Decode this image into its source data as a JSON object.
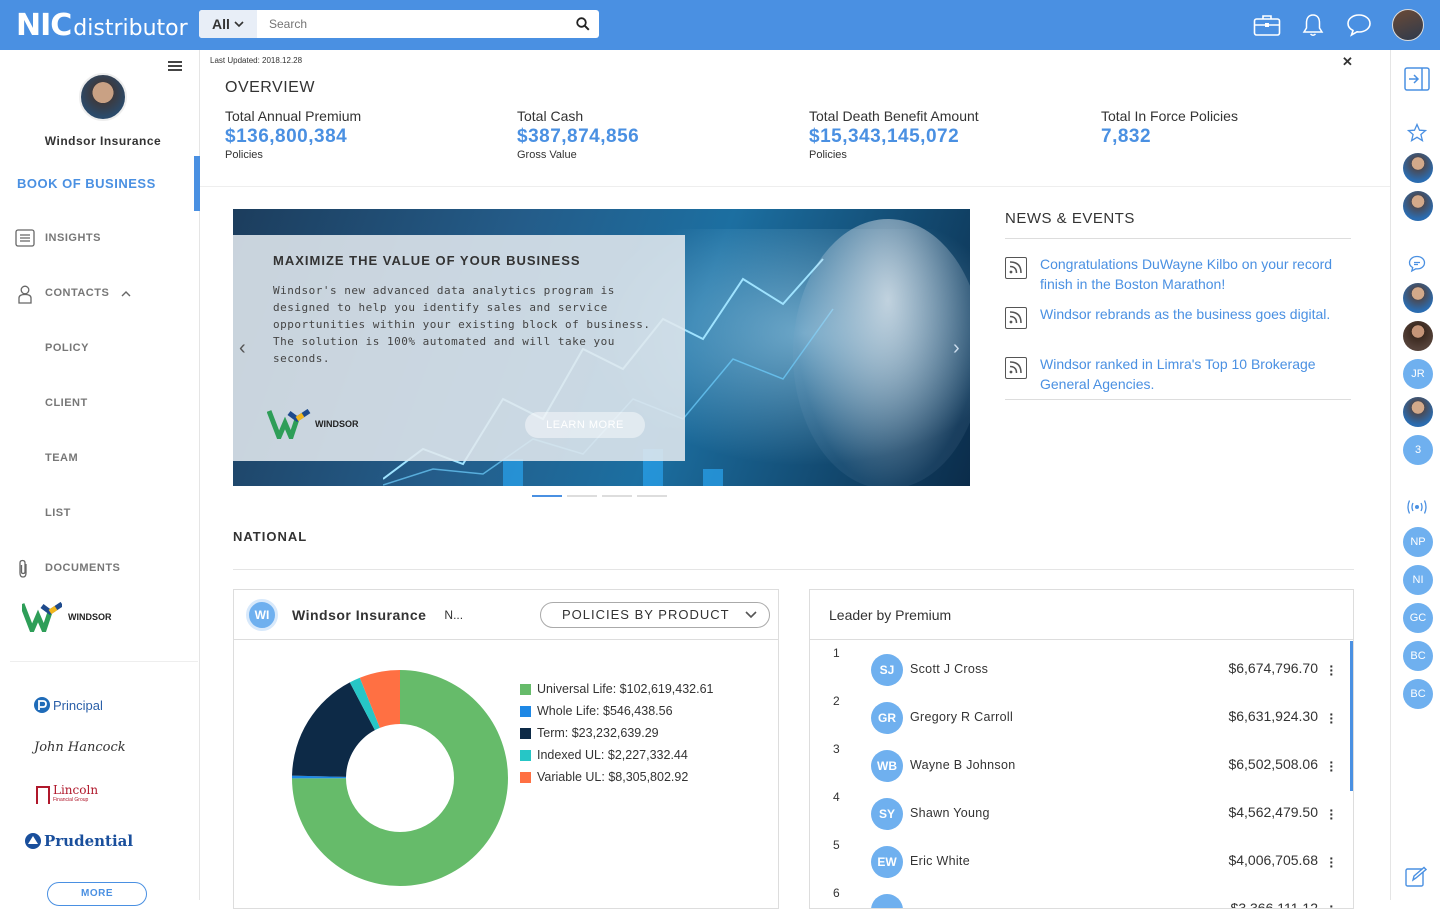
{
  "topbar": {
    "logo_main": "NIC",
    "logo_sub": "distributor",
    "search_scope": "All",
    "search_placeholder": "Search"
  },
  "sidebar": {
    "profile_name": "Windsor Insurance",
    "active_item": "BOOK OF BUSINESS",
    "items": [
      {
        "label": "INSIGHTS",
        "icon": "list-icon"
      },
      {
        "label": "CONTACTS",
        "icon": "person-icon"
      },
      {
        "label": "POLICY"
      },
      {
        "label": "CLIENT"
      },
      {
        "label": "TEAM"
      },
      {
        "label": "LIST"
      },
      {
        "label": "DOCUMENTS",
        "icon": "paperclip-icon"
      }
    ],
    "brand_logo": "WINDSOR",
    "partners": [
      "Principal",
      "John Hancock",
      "Lincoln",
      "Prudential"
    ],
    "lincoln_sub": "Financial Group",
    "more_label": "MORE"
  },
  "overview": {
    "last_updated": "Last Updated: 2018.12.28",
    "title": "OVERVIEW",
    "stats": [
      {
        "label": "Total Annual Premium",
        "value": "$136,800,384",
        "sub": "Policies"
      },
      {
        "label": "Total Cash",
        "value": "$387,874,856",
        "sub": "Gross Value"
      },
      {
        "label": "Total Death Benefit Amount",
        "value": "$15,343,145,072",
        "sub": "Policies"
      },
      {
        "label": "Total In Force Policies",
        "value": "7,832",
        "sub": ""
      }
    ]
  },
  "carousel": {
    "title": "MAXIMIZE THE VALUE OF YOUR BUSINESS",
    "body": "Windsor's new advanced data analytics program is designed to help you identify sales and service opportunities within your existing block of business. The solution is 100% automated and will take you seconds.",
    "cta": "LEARN MORE",
    "logo_text": "WINDSOR",
    "active_slide": 1,
    "slide_count": 4
  },
  "news": {
    "title": "NEWS & EVENTS",
    "items": [
      "Congratulations DuWayne Kilbo on your record finish in the Boston Marathon!",
      "Windsor rebrands as the business goes digital.",
      "Windsor ranked in Limra's Top 10 Brokerage General Agencies."
    ]
  },
  "national": {
    "title": "NATIONAL",
    "card": {
      "badge": "WI",
      "name": "Windsor Insurance",
      "sub": "N...",
      "dropdown": "POLICIES BY PRODUCT"
    },
    "chart_data": {
      "type": "pie",
      "categories": [
        "Universal Life",
        "Whole Life",
        "Term",
        "Indexed UL",
        "Variable UL"
      ],
      "values": [
        102619432.61,
        546438.56,
        23232639.29,
        2227332.44,
        8305802.92
      ],
      "labels": [
        "Universal Life: $102,619,432.61",
        "Whole Life: $546,438.56",
        "Term: $23,232,639.29",
        "Indexed UL: $2,227,332.44",
        "Variable UL: $8,305,802.92"
      ],
      "colors": [
        "#66bb6a",
        "#1e88e5",
        "#0d2a47",
        "#26c6c6",
        "#ff7043"
      ],
      "legend": "right"
    }
  },
  "leaders": {
    "title": "Leader by Premium",
    "rows": [
      {
        "rank": "1",
        "initials": "SJ",
        "name": "Scott J Cross",
        "amount": "$6,674,796.70"
      },
      {
        "rank": "2",
        "initials": "GR",
        "name": "Gregory R Carroll",
        "amount": "$6,631,924.30"
      },
      {
        "rank": "3",
        "initials": "WB",
        "name": "Wayne B Johnson",
        "amount": "$6,502,508.06"
      },
      {
        "rank": "4",
        "initials": "SY",
        "name": "Shawn Young",
        "amount": "$4,562,479.50"
      },
      {
        "rank": "5",
        "initials": "EW",
        "name": "Eric White",
        "amount": "$4,006,705.68"
      },
      {
        "rank": "6",
        "initials": "",
        "name": "",
        "amount": "$3,366,111.12"
      }
    ]
  },
  "rail": {
    "initials": [
      "JR",
      "3",
      "NP",
      "NI",
      "GC",
      "BC",
      "BC"
    ]
  }
}
